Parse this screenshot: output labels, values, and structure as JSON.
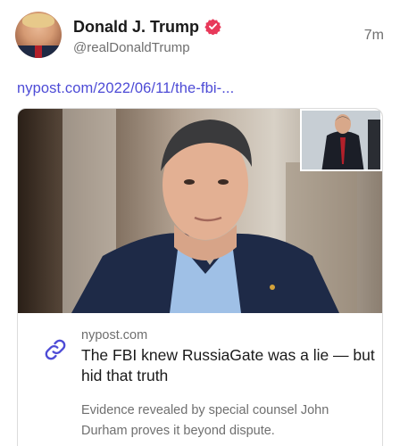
{
  "author": {
    "display_name": "Donald J. Trump",
    "handle": "@realDonaldTrump",
    "verified_badge_color": "#e8395a",
    "avatar_icon": "user-avatar-photo"
  },
  "post": {
    "timestamp": "7m",
    "link_text": "nypost.com/2022/06/11/the-fbi-...",
    "link_color": "#4d4bd6"
  },
  "link_card": {
    "domain": "nypost.com",
    "title": "The FBI knew RussiaGate was a lie — but hid that truth",
    "description": "Evidence revealed by special counsel John Durham proves it beyond dispute.",
    "icon": "link-icon",
    "icon_color": "#4d4bd6"
  }
}
